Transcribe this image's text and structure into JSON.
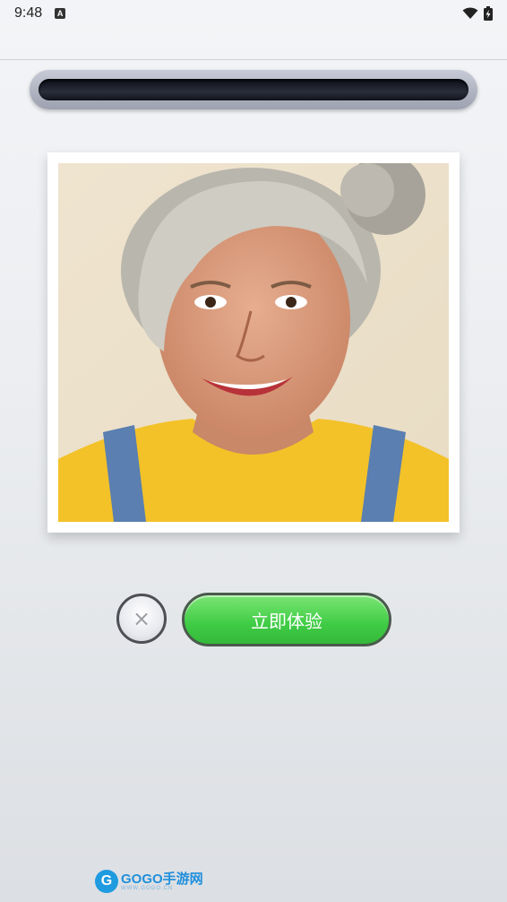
{
  "status_bar": {
    "time": "9:48",
    "notification_icon": "a-badge-icon",
    "wifi_icon": "wifi-icon",
    "battery_icon": "battery-charging-icon"
  },
  "photo": {
    "description_icon": "portrait-photo"
  },
  "actions": {
    "close_symbol": "×",
    "primary_label": "立即体验"
  },
  "watermark": {
    "title": "GOGO手游网",
    "subtitle": "WWW.GOGO.CN"
  },
  "colors": {
    "primary_button": "#3fcc45",
    "slot_dark": "#0c0f1a",
    "frame": "#ffffff"
  }
}
